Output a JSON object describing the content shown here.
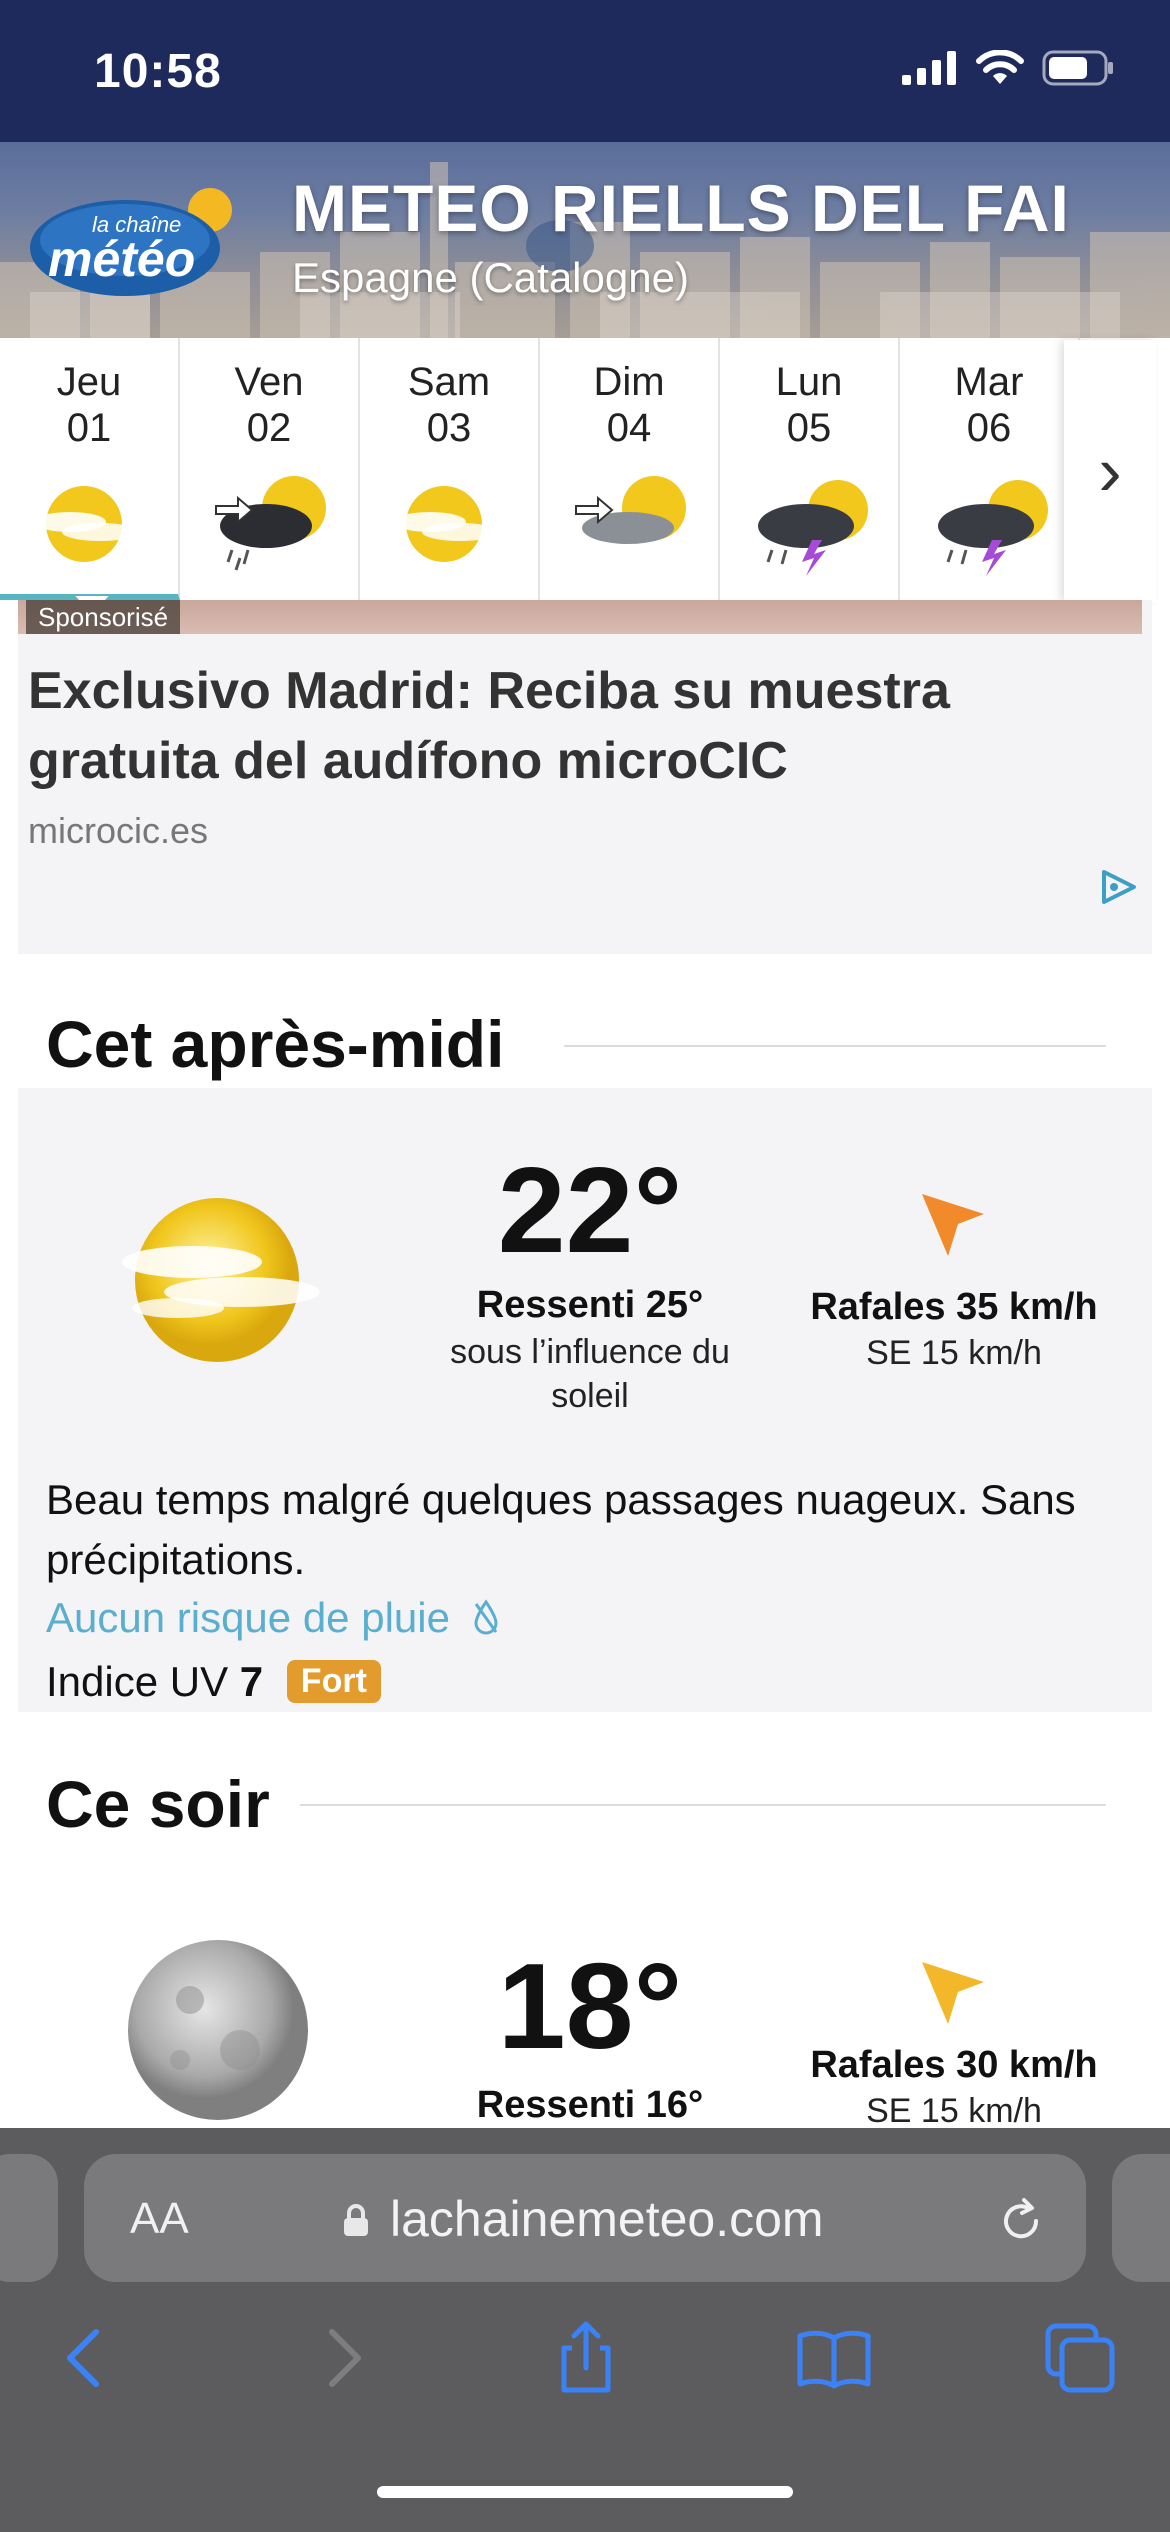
{
  "status_bar": {
    "time": "10:58"
  },
  "header": {
    "logo_line1": "la chaîne",
    "logo_line2": "météo",
    "title": "METEO RIELLS DEL FAI",
    "region": "Espagne (Catalogne)"
  },
  "days": [
    {
      "name": "Jeu",
      "num": "01",
      "icon": "sun-cloud-icon"
    },
    {
      "name": "Ven",
      "num": "02",
      "icon": "sun-rain-wind-icon"
    },
    {
      "name": "Sam",
      "num": "03",
      "icon": "sun-cloud-icon"
    },
    {
      "name": "Dim",
      "num": "04",
      "icon": "sun-cloud-wind-icon"
    },
    {
      "name": "Lun",
      "num": "05",
      "icon": "storm-sun-icon"
    },
    {
      "name": "Mar",
      "num": "06",
      "icon": "storm-sun-icon"
    }
  ],
  "ad": {
    "sponsored": "Sponsorisé",
    "title": "Exclusivo Madrid: Reciba su muestra gratuita del audífono microCIC",
    "domain": "microcic.es"
  },
  "afternoon": {
    "heading": "Cet après-midi",
    "temp": "22°",
    "feels": "Ressenti 25°",
    "feels_note": "sous l’influence du soleil",
    "gusts": "Rafales 35 km/h",
    "wind": "SE 15 km/h",
    "description": "Beau temps malgré quelques passages nuageux. Sans précipitations.",
    "rain": "Aucun risque de pluie",
    "uv_label": "Indice UV",
    "uv_value": "7",
    "uv_badge": "Fort"
  },
  "evening": {
    "heading": "Ce soir",
    "temp": "18°",
    "feels": "Ressenti 16°",
    "gusts": "Rafales 30 km/h",
    "wind": "SE 15 km/h"
  },
  "browser": {
    "aa_label": "AA",
    "url": "lachainemeteo.com"
  },
  "colors": {
    "status_bg": "#1f2a5c",
    "accent_teal": "#58b6c0",
    "uv_badge": "#e39b2e",
    "rain_link": "#5aaed0",
    "arrow_orange": "#f08a2a",
    "arrow_yellow": "#f2b82a"
  }
}
